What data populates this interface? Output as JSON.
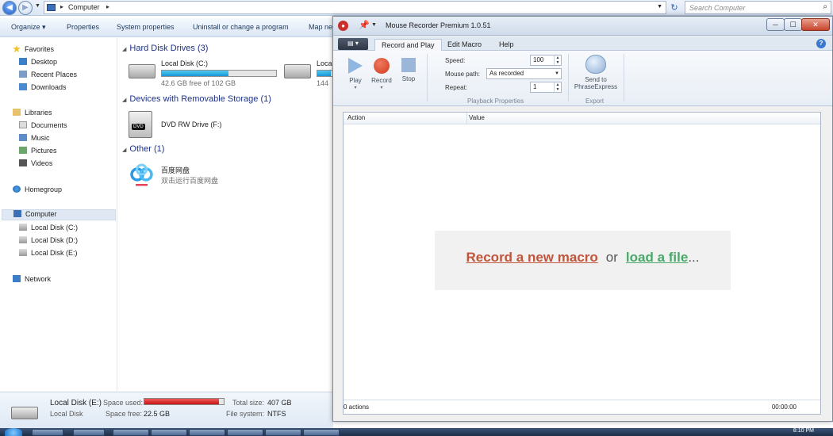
{
  "explorer": {
    "address": {
      "crumb": "Computer",
      "search_placeholder": "Search Computer"
    },
    "commands": [
      "Organize ▾",
      "Properties",
      "System properties",
      "Uninstall or change a program",
      "Map ne"
    ],
    "nav": {
      "favorites": "Favorites",
      "desktop": "Desktop",
      "recent_places": "Recent Places",
      "downloads": "Downloads",
      "libraries": "Libraries",
      "documents": "Documents",
      "music": "Music",
      "pictures": "Pictures",
      "videos": "Videos",
      "homegroup": "Homegroup",
      "computer": "Computer",
      "disk_c": "Local Disk (C:)",
      "disk_d": "Local Disk (D:)",
      "disk_e": "Local Disk (E:)",
      "network": "Network"
    },
    "groups": {
      "hdd": "Hard Disk Drives (3)",
      "removable": "Devices with Removable Storage (1)",
      "other": "Other (1)"
    },
    "drives": {
      "c_name": "Local Disk (C:)",
      "c_free": "42.6 GB free of 102 GB",
      "c_used_fraction": 0.58,
      "d_name_partial": "Local",
      "d_free_partial": "144",
      "d_used_fraction": 0.9,
      "dvd_name": "DVD RW Drive (F:)",
      "dvd_badge": "DVD",
      "baidu_name": "百度网盘",
      "baidu_desc": "双击运行百度网盘"
    },
    "details": {
      "name": "Local Disk (E:)",
      "type": "Local Disk",
      "space_used_label": "Space used:",
      "space_free_label": "Space free:",
      "space_free": "22.5 GB",
      "total_label": "Total size:",
      "total": "407 GB",
      "fs_label": "File system:",
      "fs": "NTFS",
      "used_fraction": 0.94
    }
  },
  "recorder": {
    "title": "Mouse Recorder Premium 1.0.51",
    "tabs": [
      "Record and Play",
      "Edit Macro",
      "Help"
    ],
    "ribbon": {
      "play": "Play",
      "record": "Record",
      "stop": "Stop",
      "speed_label": "Speed:",
      "speed_value": "100",
      "mouse_path_label": "Mouse path:",
      "mouse_path_value": "As recorded",
      "repeat_label": "Repeat:",
      "repeat_value": "1",
      "playback_caption": "Playback Properties",
      "send_to_line1": "Send to",
      "send_to_line2": "PhraseExpress",
      "export_caption": "Export"
    },
    "list": {
      "col_action": "Action",
      "col_value": "Value",
      "record_link": "Record a new macro",
      "or_text": "or",
      "load_link": "load a file",
      "ellipsis": "...",
      "count": "0 actions",
      "time": "00:00:00"
    }
  },
  "taskbar": {
    "clock": "8:10 PM"
  }
}
